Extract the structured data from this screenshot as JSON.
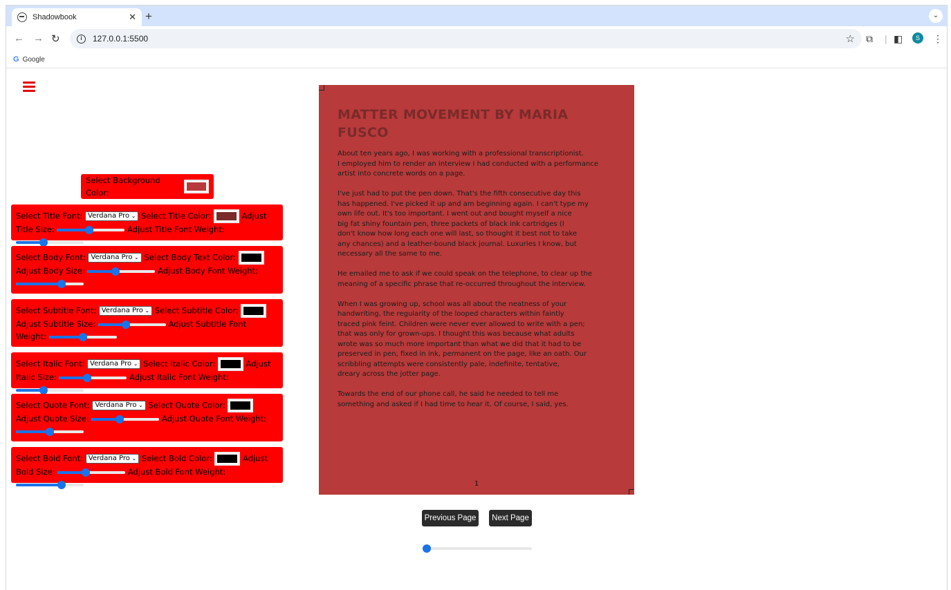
{
  "browser": {
    "tab_title": "Shadowbook",
    "tab_close": "✕",
    "new_tab": "+",
    "tab_menu": "⌄",
    "url": "127.0.0.1:5500",
    "bookmark_google": "Google",
    "profile_initial": "S",
    "icons": [
      "back-icon",
      "forward-icon",
      "reload-icon",
      "info-icon",
      "star-icon",
      "extensions-icon",
      "sidepanel-icon",
      "menu-dots-icon"
    ]
  },
  "controls": {
    "background": {
      "label": "Select Background Color:",
      "color": "#b83a3a"
    },
    "title": {
      "font_label": "Select Title Font:",
      "font_value": "Verdana Pro",
      "color_label": "Select Title Color:",
      "color": "#7a2a2a",
      "size_label": "Adjust Title Size:",
      "size_level": 0.47,
      "weight_label": "Adjust Title Font Weight:",
      "weight_level": 0.4
    },
    "body": {
      "font_label": "Select Body Font:",
      "font_value": "Verdana Pro",
      "color_label": "Select Body Text Color:",
      "color": "#000000",
      "size_label": "Adjust Body Size:",
      "size_level": 0.4,
      "weight_label": "Adjust Body Font Weight:",
      "weight_level": 0.7
    },
    "subtitle": {
      "font_label": "Select Subtitle Font:",
      "font_value": "Verdana Pro",
      "color_label": "Select Subtitle Color:",
      "color": "#000000",
      "size_label": "Adjust Subtitle Size:",
      "size_level": 0.4,
      "weight_label": "Adjust Subtitle Font Weight:",
      "weight_level": 0.5
    },
    "italic": {
      "font_label": "Select Italic Font:",
      "font_value": "Verdana Pro",
      "color_label": "Select Italic Color:",
      "color": "#000000",
      "size_label": "Adjust Italic Size:",
      "size_level": 0.4,
      "weight_label": "Adjust Italic Font Weight:",
      "weight_level": 0.4
    },
    "quote": {
      "font_label": "Select Quote Font:",
      "font_value": "Verdana Pro",
      "color_label": "Select Quote Color:",
      "color": "#000000",
      "size_label": "Adjust Quote Size:",
      "size_level": 0.4,
      "weight_label": "Adjust Quote Font Weight:",
      "weight_level": 0.5
    },
    "bold": {
      "font_label": "Select Bold Font:",
      "font_value": "Verdana Pro",
      "color_label": "Select Bold Color:",
      "color": "#000000",
      "size_label": "Adjust Bold Size:",
      "size_level": 0.4,
      "weight_label": "Adjust Bold Font Weight:",
      "weight_level": 0.7
    }
  },
  "book": {
    "title": "MATTER MOVEMENT BY MARIA FUSCO",
    "paragraphs": [
      "About ten years ago, I was working with a professional transcriptionist.\nI employed him to render an interview I had conducted with a performance\nartist into concrete words on a page.",
      "I've just had to put the pen down. That's the fifth consecutive day this\nhas happened. I've picked it up and am beginning again. I can't type my\nown life out. It's too important. I went out and bought myself a nice\nbig fat shiny fountain pen, three packets of black ink cartridges (I\ndon't know how long each one will last, so thought it best not to take\nany chances) and a leather-bound black journal. Luxuries I know, but\nnecessary all the same to me.",
      "He emailed me to ask if we could speak on the telephone, to clear up the\nmeaning of a specific phrase that re-occurred throughout the interview.",
      "When I was growing up, school was all about the neatness of your\nhandwriting, the regularity of the looped characters within faintly\ntraced pink feint. Children were never ever allowed to write with a pen;\nthat was only for grown-ups. I thought this was because what adults\nwrote was so much more important than what we did that it had to be\npreserved in pen, fixed in ink, permanent on the page, like an oath. Our\nscribbling attempts were consistently pale, indefinite, tentative,\ndreary across the jotter page.",
      "Towards the end of our phone call, he said he needed to tell me\nsomething and asked if I had time to hear it. Of course, I said, yes."
    ],
    "page_number": "1"
  },
  "navigation": {
    "prev_label": "Previous Page",
    "next_label": "Next Page",
    "page_progress": 0.0
  }
}
